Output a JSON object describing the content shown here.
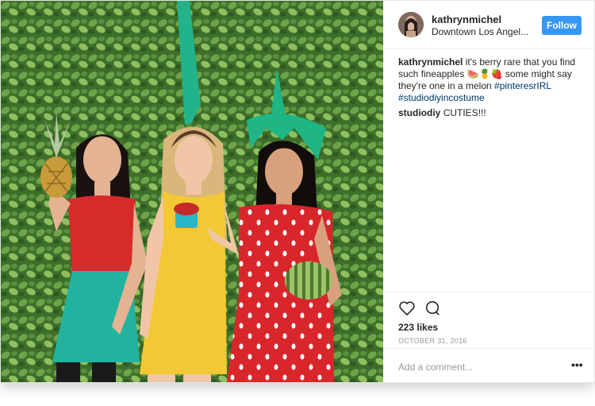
{
  "post": {
    "username": "kathrynmichel",
    "location": "Downtown Los Angel...",
    "follow_label": "Follow",
    "caption": {
      "username": "kathrynmichel",
      "text_before_emoji": "it's berry rare that you find such fineapples",
      "emoji": "🍉🍍🍓",
      "text_after_emoji": "some might say they're one in a melon",
      "hashtags": [
        "#pinteresrIRL",
        "#studiodiyincostume"
      ]
    },
    "comment": {
      "username": "studiodiy",
      "text": "CUTIES!!!"
    },
    "likes": "223 likes",
    "date": "OCTOBER 31, 2016",
    "add_comment_placeholder": "Add a comment...",
    "more_label": "•••"
  },
  "icons": [
    "heart-icon",
    "comment-icon",
    "more-options-icon"
  ],
  "colors": {
    "accent": "#3897f0",
    "hashtag": "#003569",
    "hedge": "#3f7a2e"
  }
}
